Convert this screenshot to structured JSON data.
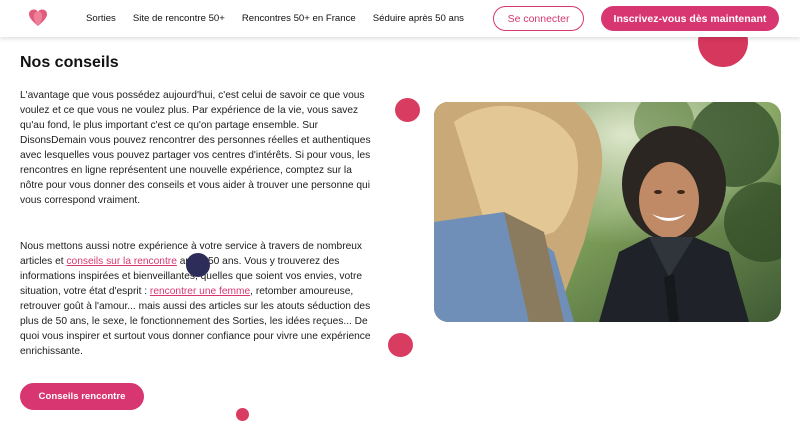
{
  "header": {
    "logo_name": "heart-logo",
    "nav": [
      "Sorties",
      "Site de rencontre 50+",
      "Rencontres 50+ en France",
      "Séduire après 50 ans"
    ],
    "login_label": "Se connecter",
    "signup_label": "Inscrivez-vous dès maintenant"
  },
  "colors": {
    "accent": "#d83670",
    "dot": "#d83d61",
    "dark_dot": "#2d2d5a"
  },
  "main": {
    "title": "Nos conseils",
    "paragraph1": "L'avantage que vous possédez aujourd'hui, c'est celui de savoir ce que vous voulez et ce que vous ne voulez plus. Par expérience de la vie, vous savez qu'au fond, le plus important c'est ce qu'on partage ensemble. Sur DisonsDemain vous pouvez rencontrer des personnes réelles et authentiques avec lesquelles vous pouvez partager vos centres d'intérêts. Si pour vous, les rencontres en ligne représentent une nouvelle expérience, comptez sur la nôtre pour vous donner des conseils et vous aider à trouver une personne qui vous correspond vraiment.",
    "paragraph2": {
      "part1": "Nous mettons aussi notre expérience à votre service à travers de nombreux articles et ",
      "link1": "conseils sur la rencontre",
      "part2": " après 50 ans. Vous y trouverez des informations inspirées et bienveillantes, quelles que soient vos envies, votre situation, votre état d'esprit : ",
      "link2": "rencontrer une femme",
      "part3": ", retomber amoureuse, retrouver goût à l'amour... mais aussi des articles sur les atouts séduction des plus de 50 ans, le sexe, le fonctionnement des Sorties, les idées reçues... De quoi vous inspirer et surtout vous donner confiance pour vivre une expérience enrichissante."
    },
    "button_label": "Conseils rencontre",
    "photo_name": "two-women-laughing-photo"
  }
}
